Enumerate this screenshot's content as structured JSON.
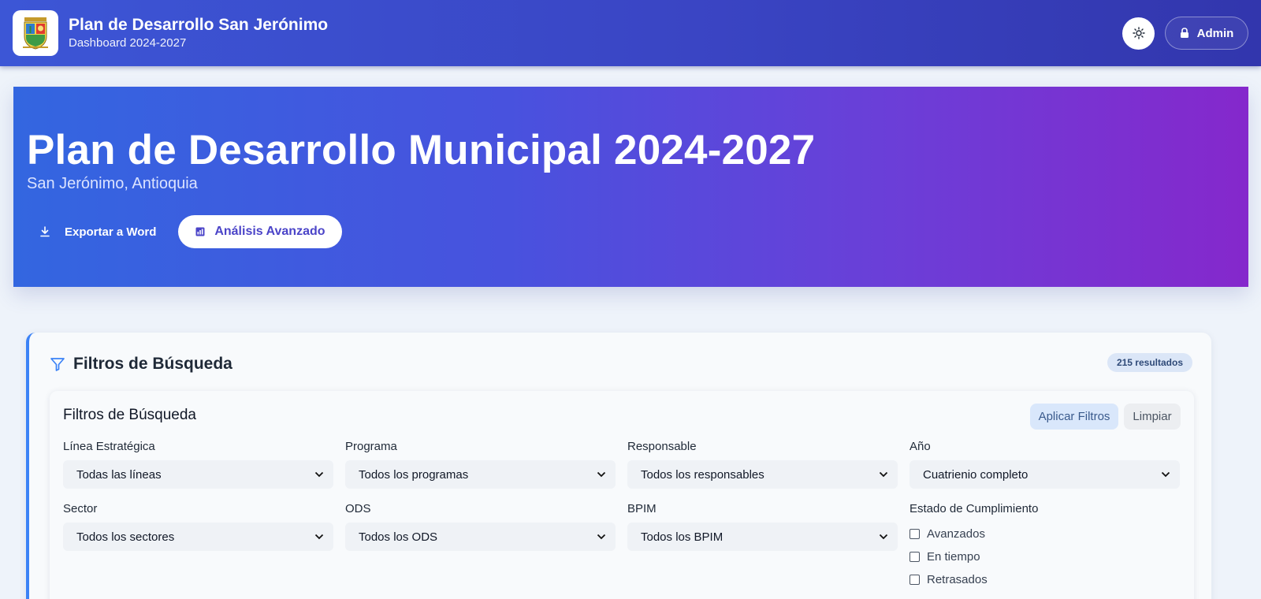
{
  "header": {
    "title": "Plan de Desarrollo San Jerónimo",
    "subtitle": "Dashboard 2024-2027",
    "admin_label": "Admin"
  },
  "hero": {
    "title": "Plan de Desarrollo Municipal 2024-2027",
    "subtitle": "San Jerónimo, Antioquia",
    "export_label": "Exportar a Word",
    "analysis_label": "Análisis Avanzado"
  },
  "filters": {
    "title": "Filtros de Búsqueda",
    "results_badge": "215 resultados",
    "panel_title": "Filtros de Búsqueda",
    "apply_label": "Aplicar Filtros",
    "clear_label": "Limpiar",
    "fields": [
      {
        "label": "Línea Estratégica",
        "value": "Todas las líneas"
      },
      {
        "label": "Programa",
        "value": "Todos los programas"
      },
      {
        "label": "Responsable",
        "value": "Todos los responsables"
      },
      {
        "label": "Año",
        "value": "Cuatrienio completo"
      },
      {
        "label": "Sector",
        "value": "Todos los sectores"
      },
      {
        "label": "ODS",
        "value": "Todos los ODS"
      },
      {
        "label": "BPIM",
        "value": "Todos los BPIM"
      }
    ],
    "status": {
      "label": "Estado de Cumplimiento",
      "options": [
        "Avanzados",
        "En tiempo",
        "Retrasados"
      ]
    }
  },
  "colors": {
    "accent": "#3b82f6",
    "header_bg": "#3a45c4",
    "hero_start": "#3366e0",
    "hero_end": "#8528cc"
  },
  "icons": {
    "theme": "sun-icon",
    "admin": "lock-icon",
    "export": "download-icon",
    "analysis": "chart-icon",
    "filter": "funnel-icon",
    "select": "chevron-down-icon"
  }
}
